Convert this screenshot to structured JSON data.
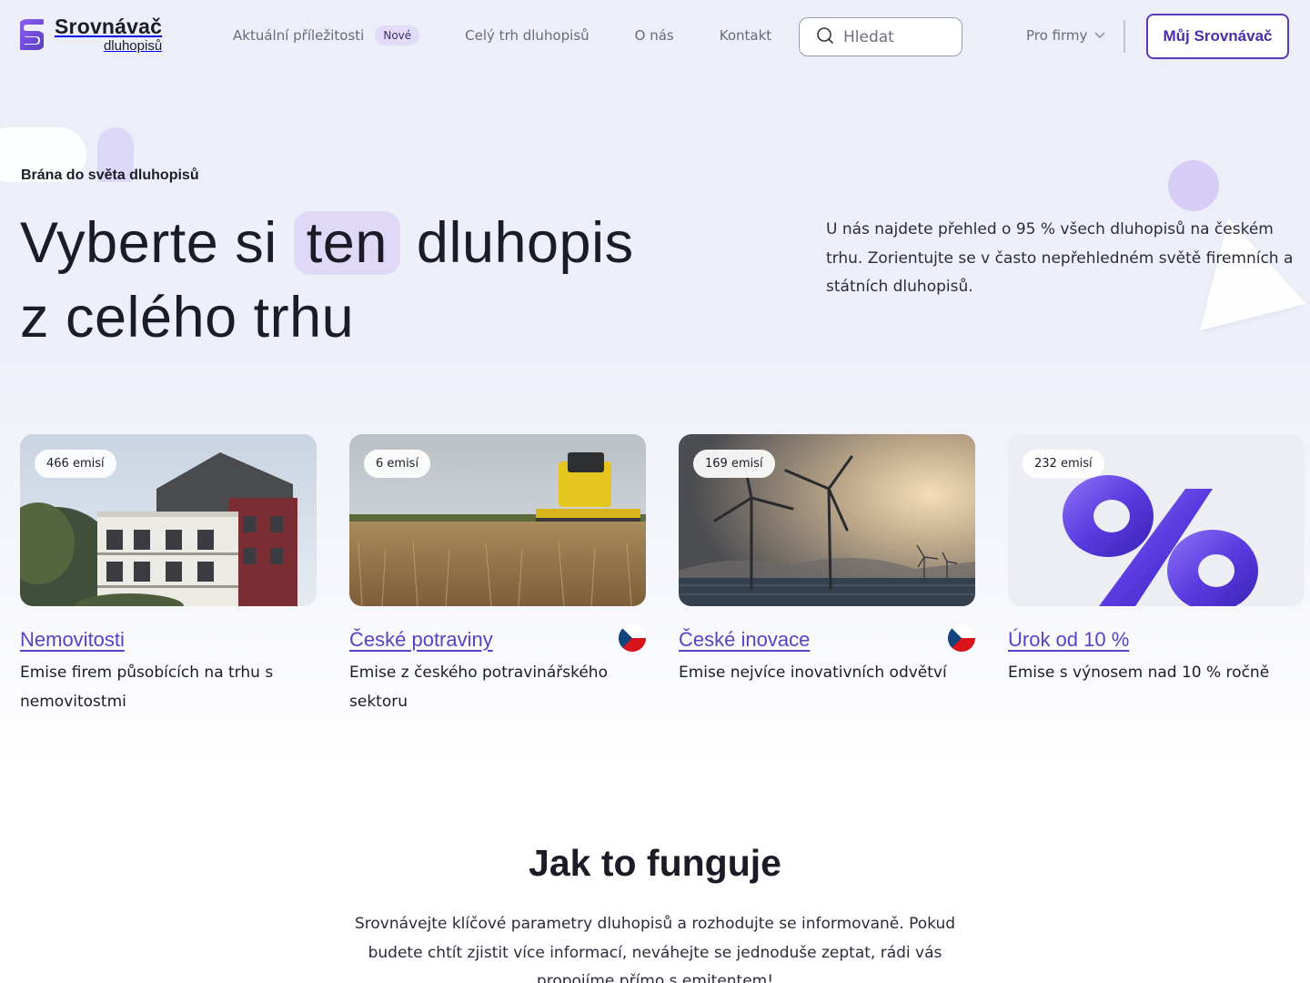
{
  "header": {
    "logo_line1": "Srovnávač",
    "logo_line2": "dluhopisů",
    "nav": [
      {
        "label": "Aktuální příležitosti",
        "badge": "Nové"
      },
      {
        "label": "Celý trh dluhopisů"
      },
      {
        "label": "O nás"
      },
      {
        "label": "Kontakt"
      }
    ],
    "search_placeholder": "Hledat",
    "pro_firmy": "Pro firmy",
    "account_button": "Můj Srovnávač",
    "brand_color": "#5a3bb8"
  },
  "hero": {
    "eyebrow": "Brána do světa dluhopisů",
    "title_before": "Vyberte si",
    "title_highlight": "ten",
    "title_after": "dluhopis",
    "title_line2": "z celého trhu",
    "description": "U nás najdete přehled o 95 % všech dluhopisů na českém trhu. Zorientujte se v často nepřehledném světě firemních a státních dluhopisů."
  },
  "cards": [
    {
      "badge": "466 emisí",
      "title": "Nemovitosti",
      "description": "Emise firem působících na trhu s nemovitostmi",
      "flag": false,
      "image": "apartment-building-photo"
    },
    {
      "badge": "6 emisí",
      "title": "České potraviny",
      "description": "Emise z českého potravinářského sektoru",
      "flag": true,
      "image": "wheat-field-harvester-photo"
    },
    {
      "badge": "169 emisí",
      "title": "České inovace",
      "description": "Emise nejvíce inovativních odvětví",
      "flag": true,
      "image": "wind-turbines-photo"
    },
    {
      "badge": "232 emisí",
      "title": "Úrok od 10 %",
      "description": "Emise s výnosem nad 10 % ročně",
      "flag": false,
      "image": "percent-symbol-3d"
    }
  ],
  "how": {
    "title": "Jak to funguje",
    "description": "Srovnávejte klíčové parametry dluhopisů a rozhodujte se informovaně. Pokud budete chtít zjistit více informací, neváhejte se jednoduše zeptat, rádi vás propojíme přímo s emitentem!"
  }
}
